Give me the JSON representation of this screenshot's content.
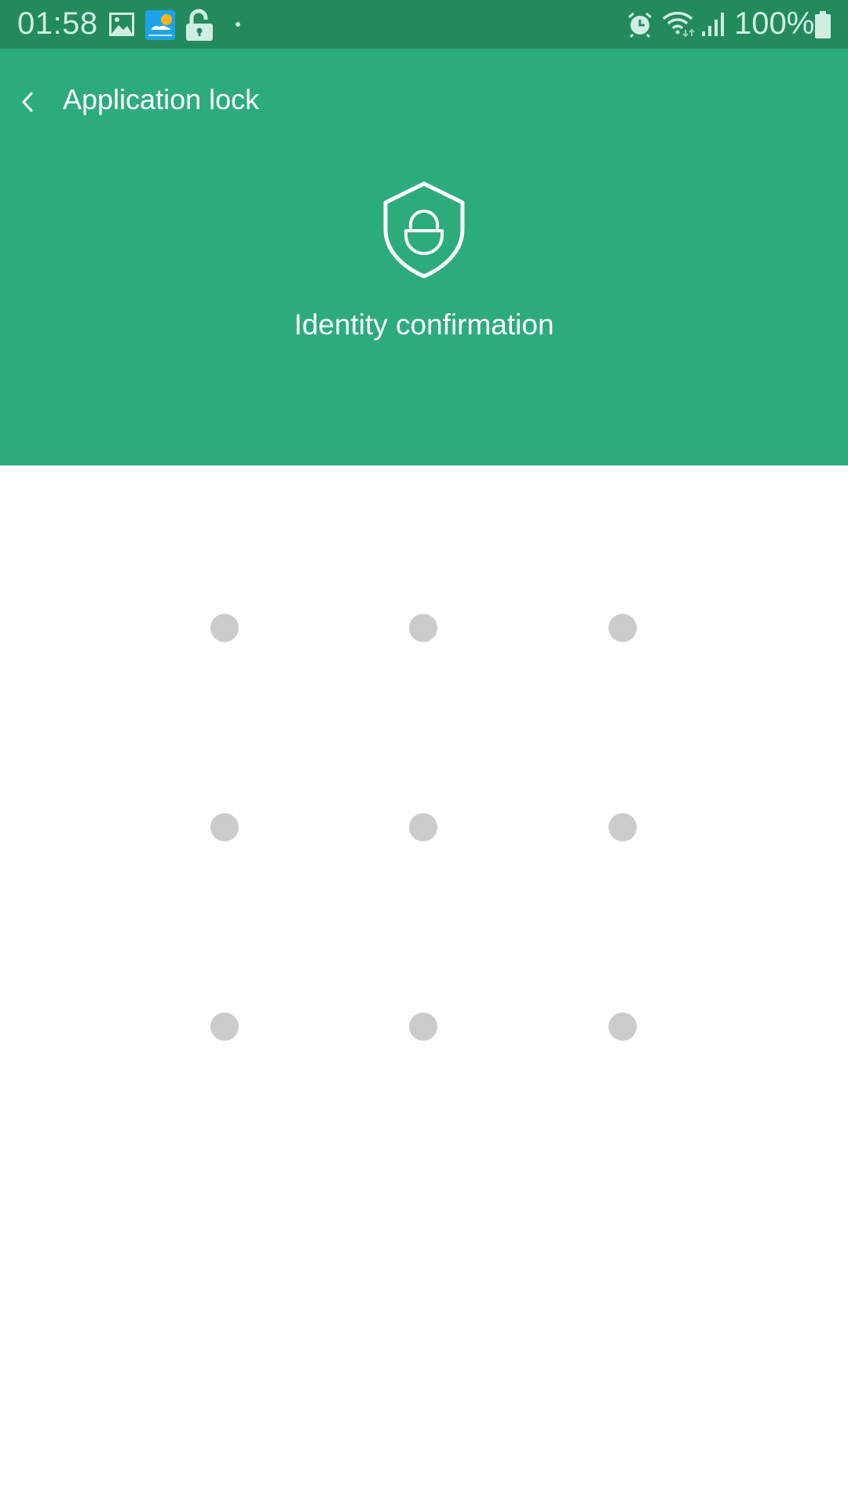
{
  "status_bar": {
    "time": "01:58",
    "left_icons": [
      "image-icon",
      "weather-app-icon",
      "unlock-icon",
      "notification-dot-icon"
    ],
    "right_icons": [
      "alarm-icon",
      "wifi-icon",
      "signal-icon"
    ],
    "battery_percent": "100%",
    "battery_level": 1.0
  },
  "header": {
    "back_icon": "chevron-left-icon",
    "title": "Application lock",
    "hero_icon": "shield-lock-icon",
    "subtitle": "Identity confirmation",
    "color": "#2dac7b",
    "status_bar_color": "#238a5e"
  },
  "pattern": {
    "rows": 3,
    "cols": 3,
    "dot_color": "#cbcbcb",
    "dots": [
      {
        "row": 1,
        "col": 1,
        "selected": false
      },
      {
        "row": 1,
        "col": 2,
        "selected": false
      },
      {
        "row": 1,
        "col": 3,
        "selected": false
      },
      {
        "row": 2,
        "col": 1,
        "selected": false
      },
      {
        "row": 2,
        "col": 2,
        "selected": false
      },
      {
        "row": 2,
        "col": 3,
        "selected": false
      },
      {
        "row": 3,
        "col": 1,
        "selected": false
      },
      {
        "row": 3,
        "col": 2,
        "selected": false
      },
      {
        "row": 3,
        "col": 3,
        "selected": false
      }
    ]
  }
}
